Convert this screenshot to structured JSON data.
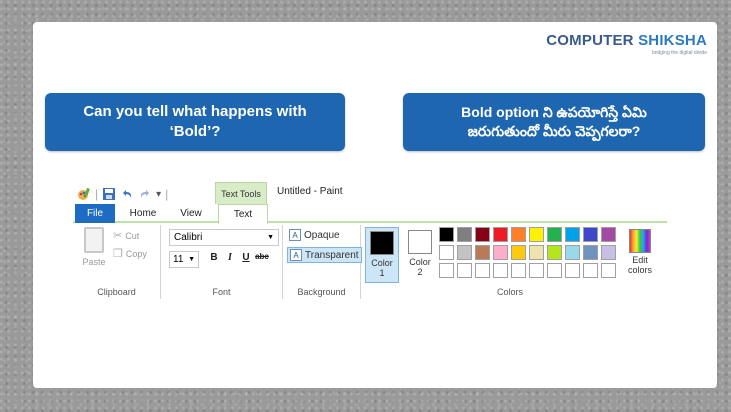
{
  "logo": {
    "part1": "COMPUTER",
    "part2": "SHIKSHA",
    "tagline": "bridging the digital divide"
  },
  "questions": {
    "english": "Can you tell what happens with\n‘Bold’?",
    "telugu": "Bold option ని ఉపయోగిస్తే ఏమి\nజరుగుతుందో మీరు చెప్పగలరా?"
  },
  "paint": {
    "qat_separator": "|",
    "qat_dropdown": "▾",
    "context_tab": "Text Tools",
    "window_title": "Untitled - Paint",
    "tabs": {
      "file": "File",
      "home": "Home",
      "view": "View",
      "text": "Text"
    },
    "clipboard": {
      "paste": "Paste",
      "cut": "Cut",
      "copy": "Copy",
      "label": "Clipboard"
    },
    "font": {
      "name": "Calibri",
      "size": "11",
      "bold": "B",
      "italic": "I",
      "underline": "U",
      "strike": "abc",
      "label": "Font"
    },
    "background": {
      "opaque": "Opaque",
      "transparent": "Transparent",
      "label": "Background"
    },
    "colors": {
      "color1": "Color\n1",
      "color2": "Color\n2",
      "edit": "Edit\ncolors",
      "label": "Colors",
      "color1_value": "#000000",
      "color2_value": "#ffffff",
      "palette": [
        "#000000",
        "#7f7f7f",
        "#880015",
        "#ed1c24",
        "#ff7f27",
        "#fff200",
        "#22b14c",
        "#00a2e8",
        "#3f48cc",
        "#a349a4",
        "#ffffff",
        "#c3c3c3",
        "#b97a57",
        "#ffaec9",
        "#ffc90e",
        "#efe4b0",
        "#b5e61d",
        "#99d9ea",
        "#7092be",
        "#c8bfe7",
        "#ffffff",
        "#ffffff",
        "#ffffff",
        "#ffffff",
        "#ffffff",
        "#ffffff",
        "#ffffff",
        "#ffffff",
        "#ffffff",
        "#ffffff"
      ]
    }
  }
}
